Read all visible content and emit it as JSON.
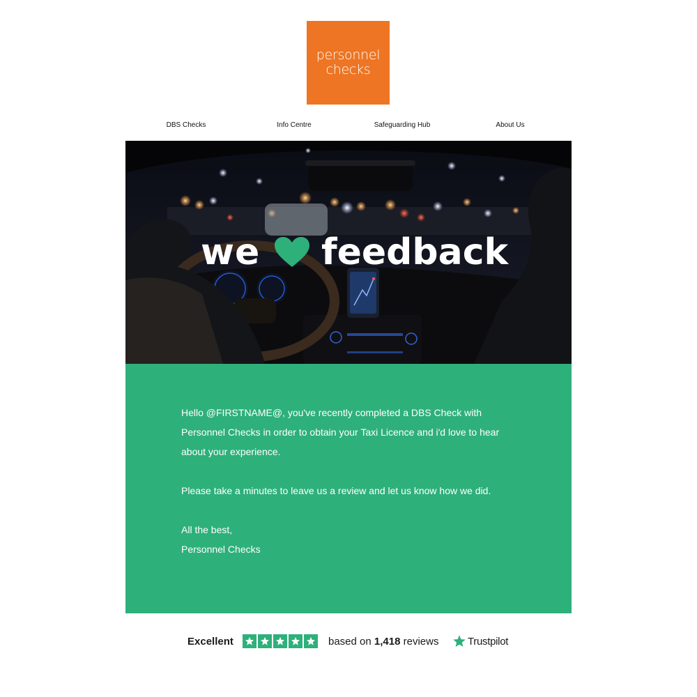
{
  "logo": {
    "line1": "personnel",
    "line2": "checks",
    "color": "#ee7523"
  },
  "nav": {
    "items": [
      {
        "label": "DBS Checks"
      },
      {
        "label": "Info Centre"
      },
      {
        "label": "Safeguarding Hub"
      },
      {
        "label": "About Us"
      }
    ]
  },
  "hero": {
    "word_left": "we",
    "word_right": "feedback",
    "heart_icon": "heart-icon",
    "heart_color": "#2eb07a"
  },
  "message": {
    "background": "#2eb07a",
    "paragraph1": "Hello @FIRSTNAME@, you've recently completed a DBS Check with Personnel Checks in order to obtain your Taxi Licence and i'd love to hear about your experience.",
    "paragraph2": "Please take a minutes to leave us a review and let us know how we did.",
    "signoff": "All the best,",
    "signature": "Personnel Checks"
  },
  "trustpilot": {
    "rating_label": "Excellent",
    "stars": 5,
    "based_on": "based on",
    "review_count": "1,418",
    "reviews_word": "reviews",
    "brand": "Trustpilot",
    "star_color": "#2eb07a"
  }
}
